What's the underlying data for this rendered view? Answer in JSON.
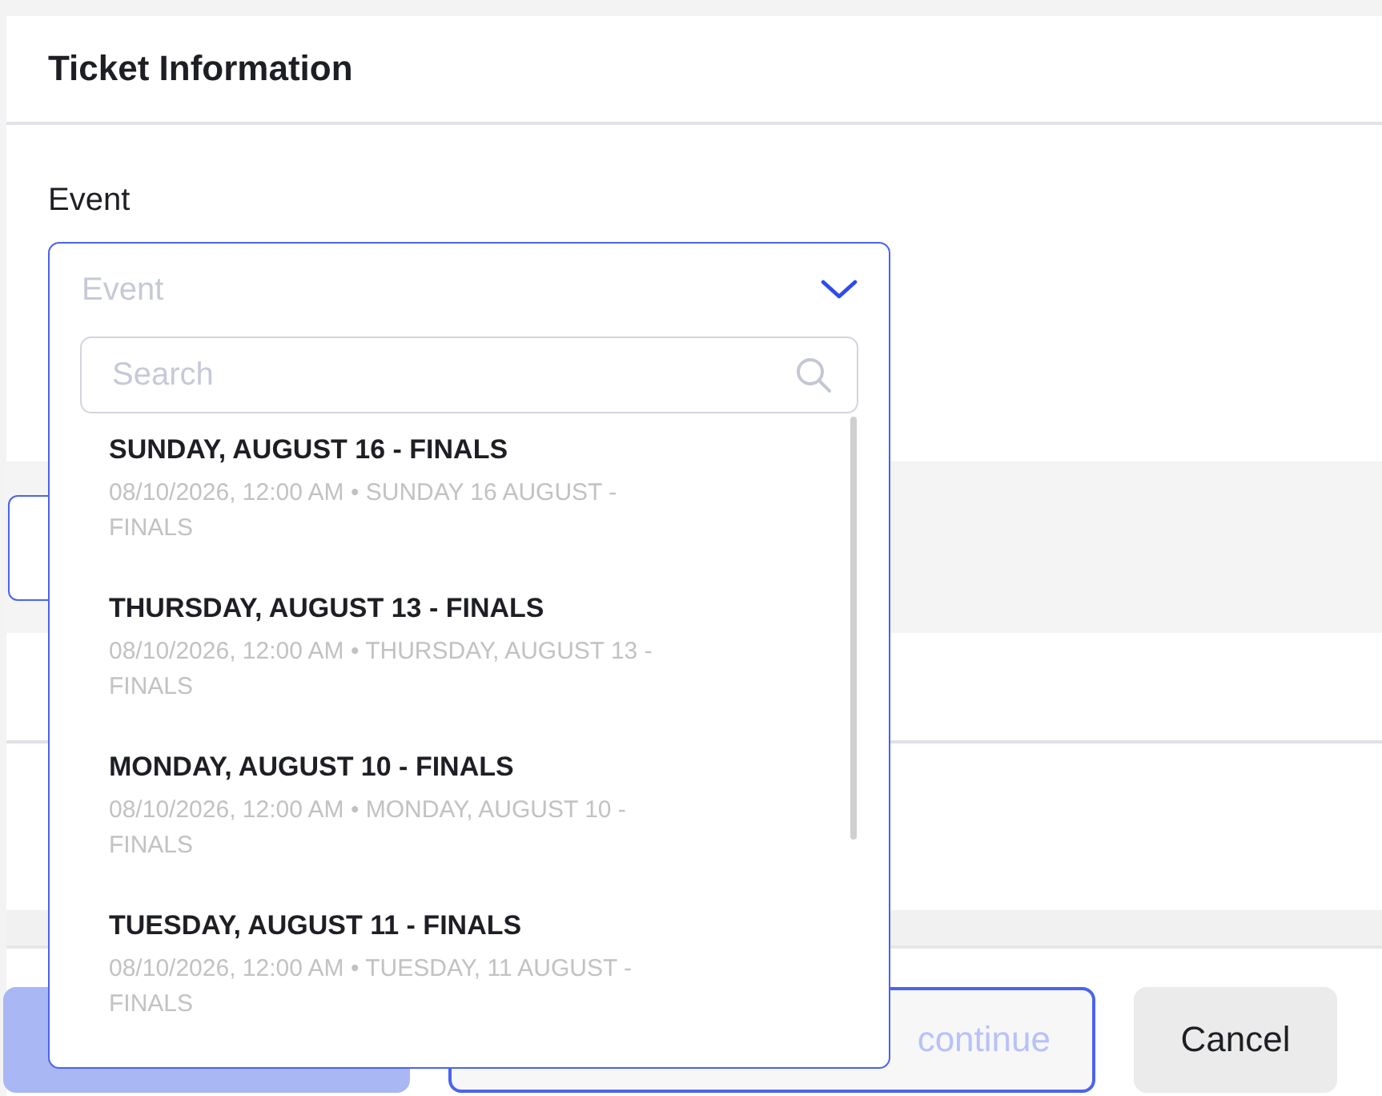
{
  "card": {
    "title": "Ticket Information"
  },
  "event_field": {
    "label": "Event",
    "placeholder": "Event",
    "expanded": true
  },
  "dropdown": {
    "search": {
      "placeholder": "Search"
    },
    "options": [
      {
        "title": "SUNDAY, AUGUST 16 - FINALS",
        "subtitle": "08/10/2026, 12:00 AM • SUNDAY 16 AUGUST - FINALS"
      },
      {
        "title": "THURSDAY, AUGUST 13 - FINALS",
        "subtitle": "08/10/2026, 12:00 AM • THURSDAY, AUGUST 13 - FINALS"
      },
      {
        "title": "MONDAY, AUGUST 10 - FINALS",
        "subtitle": "08/10/2026, 12:00 AM • MONDAY, AUGUST 10 - FINALS"
      },
      {
        "title": "TUESDAY, AUGUST 11 - FINALS",
        "subtitle": "08/10/2026, 12:00 AM • TUESDAY, 11 AUGUST - FINALS"
      }
    ]
  },
  "buttons": [
    {
      "kind": "primary",
      "disabled": true
    },
    {
      "kind": "outline",
      "label": "continue",
      "disabled": true
    },
    {
      "kind": "secondary",
      "label": "Cancel",
      "disabled": false
    }
  ]
}
